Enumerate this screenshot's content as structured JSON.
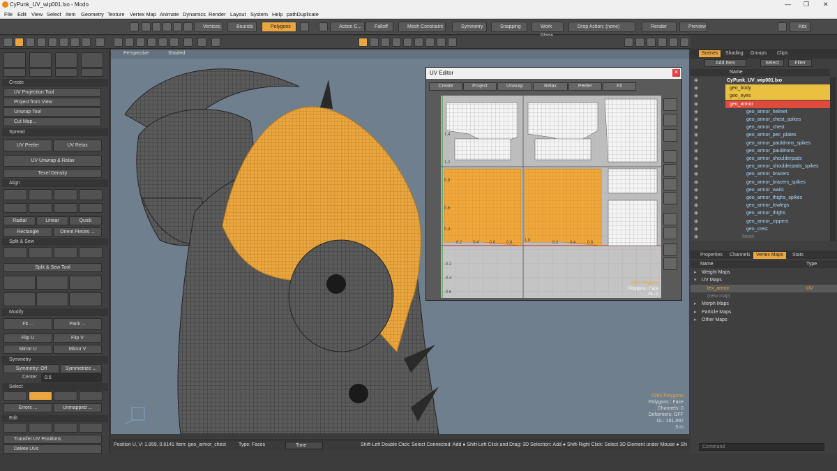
{
  "title_bar": {
    "title": "CyPunk_UV_wip001.lxo - Modo"
  },
  "menu": [
    "File",
    "Edit",
    "View",
    "Select",
    "Item",
    "Geometry",
    "Texture",
    "Vertex Map",
    "Animate",
    "Dynamics",
    "Render",
    "Layout",
    "System",
    "Help",
    "pathDuplicate"
  ],
  "toolbar": {
    "vertices": "Vertices",
    "bounds": "Bounds",
    "polygons": "Polygons",
    "action_center": "Action C...",
    "falloff": "Falloff",
    "mesh_constraint": "Mesh Constraint",
    "symmetry": "Symmetry",
    "snapping": "Snapping",
    "work_plane": "Work Plane",
    "drop_action": "Drop Action: (none)",
    "render": "Render",
    "preview": "Preview",
    "kits": "Kits"
  },
  "viewport": {
    "view": "Perspective",
    "shading": "Shaded"
  },
  "left_panel": {
    "create": "Create",
    "uv_projection_tool": "UV Projection Tool",
    "project_from_view": "Project from View",
    "unwrap_tool": "Unwrap Tool",
    "cut_map": "Cut Map...",
    "spread": "Spread",
    "uv_peeler": "UV Peeler",
    "uv_relax": "UV Relax",
    "uv_unwrap_relax": "UV Unwrap & Relax",
    "texel_density": "Texel Density",
    "align": "Align",
    "radial": "Radial",
    "linear": "Linear",
    "quick": "Quick",
    "rectangle": "Rectangle",
    "orient_pieces": "Orient Pieces ...",
    "split_sew": "Split & Sew",
    "split_sew_tool": "Split & Sew Tool",
    "modify": "Modify",
    "fit": "Fit ...",
    "pack": "Pack ...",
    "flip_u": "Flip U",
    "flip_v": "Flip V",
    "mirror_u": "Mirror U",
    "mirror_v": "Mirror V",
    "symmetry": "Symmetry",
    "symmetry_off": "Symmetry: Off",
    "symmetrize": "Symmetrize ...",
    "center_label": "Center",
    "center_value": "0.5",
    "select": "Select",
    "errors": "Errors ...",
    "unmapped": "Unmapped ...",
    "edit": "Edit",
    "transfer_uv": "Transfer UV Positions",
    "delete_uvs": "Delete UVs"
  },
  "uv_editor": {
    "title": "UV Editor",
    "tabs": [
      "Create",
      "Project",
      "Unwrap",
      "Relax",
      "Peeler",
      "Fit"
    ],
    "axis_u": [
      "0.2",
      "0.4",
      "0.6",
      "0.8",
      "1.0",
      "0.2",
      "0.4",
      "0.6"
    ],
    "axis_v_top": [
      "1.4",
      "1.2"
    ],
    "axis_v_mid": [
      "0.8",
      "0.6",
      "0.4"
    ],
    "axis_v_bot": [
      "-0.2",
      "-0.4",
      "-0.6"
    ],
    "info": [
      "4364 Polygons",
      "Polygons : Face",
      "GL: 0"
    ]
  },
  "scene": {
    "tabs": [
      "Scenes",
      "Shading",
      "Groups",
      "Clips"
    ],
    "add_item": "Add Item",
    "select": "Select",
    "filter": "Filter",
    "name_header": "Name",
    "items": [
      {
        "name": "CyPunk_UV_wip001.lxo",
        "kind": "scene"
      },
      {
        "name": "geo_body",
        "kind": "hl"
      },
      {
        "name": "geo_eyes",
        "kind": "hl"
      },
      {
        "name": "geo_armor",
        "kind": "sel"
      },
      {
        "name": "geo_armor_helmet",
        "kind": "item"
      },
      {
        "name": "geo_armor_chest_spikes",
        "kind": "item"
      },
      {
        "name": "geo_armor_chest",
        "kind": "item"
      },
      {
        "name": "geo_armor_pec_plates",
        "kind": "item"
      },
      {
        "name": "geo_armor_pauldrons_spikes",
        "kind": "item"
      },
      {
        "name": "geo_armor_pauldrons",
        "kind": "item"
      },
      {
        "name": "geo_armor_shoulderpads",
        "kind": "item"
      },
      {
        "name": "geo_armor_shoulderpads_spikes",
        "kind": "item"
      },
      {
        "name": "geo_armor_bracers",
        "kind": "item"
      },
      {
        "name": "geo_armor_bracers_spikes",
        "kind": "item"
      },
      {
        "name": "geo_armor_waist",
        "kind": "item"
      },
      {
        "name": "geo_armor_thighs_spikes",
        "kind": "item"
      },
      {
        "name": "geo_armor_lowlegs",
        "kind": "item"
      },
      {
        "name": "geo_armor_thighs",
        "kind": "item"
      },
      {
        "name": "geo_armor_zippers",
        "kind": "item"
      },
      {
        "name": "geo_crest",
        "kind": "item"
      },
      {
        "name": "Mesh",
        "kind": "dim"
      }
    ]
  },
  "props": {
    "tabs": [
      "Properties",
      "Channels",
      "Vertex Maps",
      "Stats"
    ],
    "header_name": "Name",
    "header_type": "Type",
    "rows": [
      {
        "name": "Weight Maps",
        "type": "",
        "kind": "group"
      },
      {
        "name": "UV Maps",
        "type": "",
        "kind": "group"
      },
      {
        "name": "tex_armor",
        "type": "UV",
        "kind": "sel"
      },
      {
        "name": "(new map)",
        "type": "",
        "kind": "dim"
      },
      {
        "name": "Morph Maps",
        "type": "",
        "kind": "group"
      },
      {
        "name": "Particle Maps",
        "type": "",
        "kind": "group"
      },
      {
        "name": "Other Maps",
        "type": "",
        "kind": "group"
      }
    ]
  },
  "stats": [
    "4364 Polygons",
    "Polygons : Face",
    "Channels: 0",
    "Deformers: OFF",
    "GL: 181,892",
    "5 m"
  ],
  "status": {
    "position": "Position U, V:   1.959, 0.6141",
    "item": "Item:  geo_armor_chest",
    "type": "Type:  Faces",
    "time": "Time",
    "hint": "Shift-Left Double Click: Select Connected: Add  ●  Shift-Left Click and Drag: 3D Selection: Add  ●  Shift-Right Click: Select 3D Element under Mouse  ●  Shif..."
  },
  "command_placeholder": "Command",
  "colors": {
    "accent": "#e9a640",
    "selection": "#e04a3a",
    "uv_bg": "#c4c4c4"
  }
}
